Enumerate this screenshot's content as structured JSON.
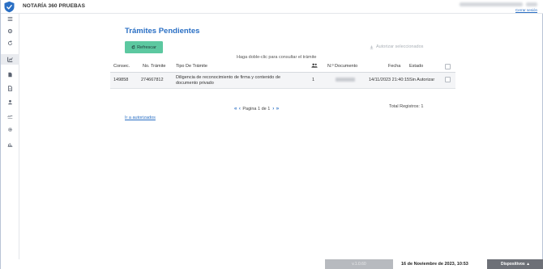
{
  "app": {
    "title": "NOTARÍA 360 PRUEBAS",
    "logout_label": "Cerrar sesión"
  },
  "sidebar": {
    "items": [
      {
        "icon": "menu-icon"
      },
      {
        "icon": "gear-icon"
      },
      {
        "icon": "refresh-icon"
      },
      {
        "icon": "chart-icon",
        "active": true
      },
      {
        "icon": "document-icon"
      },
      {
        "icon": "file-icon"
      },
      {
        "icon": "user-icon"
      },
      {
        "icon": "signature-icon"
      },
      {
        "icon": "settings-icon"
      },
      {
        "icon": "report-icon"
      }
    ]
  },
  "main": {
    "title": "Trámites Pendientes",
    "refresh_label": "Refrescar",
    "authorize_selected_label": "Autorizar seleccionados",
    "hint": "Haga doble-clic para consultar el trámite",
    "table": {
      "headers": {
        "consec": "Consec.",
        "no_tramite": "No. Trámite",
        "tipo": "Tipo De Trámite",
        "documento": "N.º Documento",
        "fecha": "Fecha",
        "estado": "Estado"
      },
      "rows": [
        {
          "consec": "149858",
          "no_tramite": "274667812",
          "tipo": "Diligencia de reconocimiento de firma y contenido de documento privado",
          "personas": "1",
          "fecha": "14/11/2023 21:40:15",
          "estado": "Sin Autorizar"
        }
      ]
    },
    "pagination": {
      "text": "Pagina 1 de 1"
    },
    "total": "Total Registros: 1",
    "link_authorized": "Ir a autorizados"
  },
  "footer": {
    "version": "v.1.0.60",
    "date": "16 de Noviembre de 2023, 10:53",
    "devices": "Dispositivos ▲"
  },
  "colors": {
    "accent": "#2a6fc4",
    "refresh": "#5cc8a0"
  }
}
